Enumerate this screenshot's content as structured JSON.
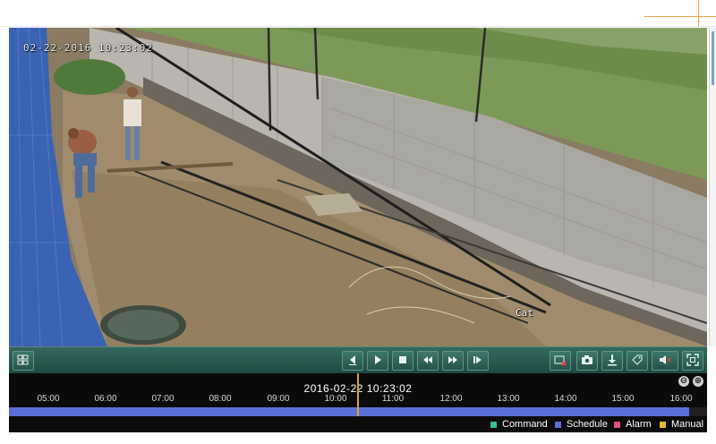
{
  "window": {
    "accent_color": "#f0a040"
  },
  "video": {
    "osd_timestamp": "02-22-2016 10:23:02",
    "object_label": "Cat"
  },
  "toolbar": {
    "icons": [
      "layout-icon",
      "prev-frame-icon",
      "play-icon",
      "stop-icon",
      "rewind-icon",
      "fast-forward-icon",
      "next-frame-icon",
      "clip-icon",
      "snapshot-icon",
      "download-icon",
      "tag-icon",
      "volume-icon",
      "fullscreen-icon"
    ]
  },
  "timeline": {
    "current_datetime": "2016-02-22 10:23:02",
    "hours": [
      "05:00",
      "06:00",
      "07:00",
      "08:00",
      "09:00",
      "10:00",
      "11:00",
      "12:00",
      "13:00",
      "14:00",
      "15:00",
      "16:00"
    ],
    "zoom_out_label": "⊖",
    "zoom_in_label": "⊕",
    "track_color": "#5a6fd8",
    "cursor_color": "#e0a02a"
  },
  "legend": {
    "items": [
      {
        "label": "Command",
        "color": "#2fbf8f"
      },
      {
        "label": "Schedule",
        "color": "#5a6fd8"
      },
      {
        "label": "Alarm",
        "color": "#e0507a"
      },
      {
        "label": "Manual",
        "color": "#e8b830"
      }
    ]
  }
}
